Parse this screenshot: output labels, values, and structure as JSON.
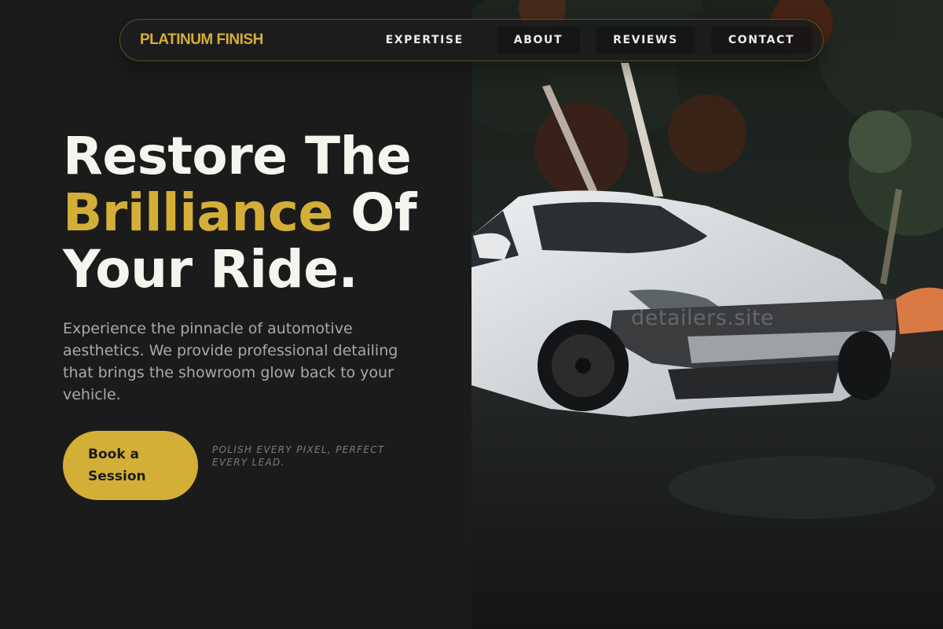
{
  "brand": {
    "name": "PLATINUM FINISH"
  },
  "nav": {
    "items": [
      {
        "label": "EXPERTISE"
      },
      {
        "label": "ABOUT"
      },
      {
        "label": "REVIEWS"
      },
      {
        "label": "CONTACT"
      }
    ]
  },
  "hero": {
    "headline_line1": "Restore The",
    "headline_accent": "Brilliance",
    "headline_line2_rest": " Of",
    "headline_line3": "Your Ride.",
    "subtext": "Experience the pinnacle of automotive aesthetics. We provide professional detailing that brings the showroom glow back to your vehicle.",
    "cta_label": "Book a Session",
    "tagline": "Polish every pixel, perfect every lead.",
    "watermark": "detailers.site"
  },
  "colors": {
    "background": "#1b1b1b",
    "accent": "#d4af37",
    "headline": "#f6f4ee",
    "body_text": "#a9a9ab"
  },
  "photo": {
    "description_icon": "car-photo"
  }
}
